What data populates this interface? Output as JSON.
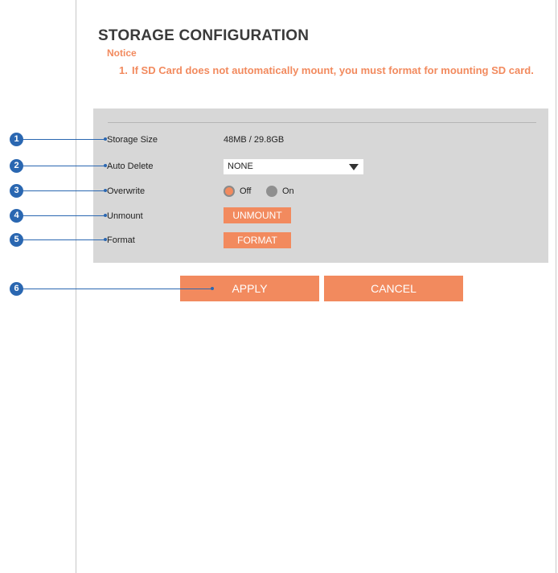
{
  "page": {
    "title": "STORAGE CONFIGURATION",
    "notice_title": "Notice",
    "notice_items": [
      {
        "number": "1.",
        "text": "If SD Card does not automatically mount, you must format for mounting SD card."
      }
    ]
  },
  "form": {
    "storage_size": {
      "label": "Storage Size",
      "value": "48MB / 29.8GB"
    },
    "auto_delete": {
      "label": "Auto Delete",
      "selected": "NONE"
    },
    "overwrite": {
      "label": "Overwrite",
      "options": [
        {
          "label": "Off",
          "checked": true
        },
        {
          "label": "On",
          "checked": false
        }
      ]
    },
    "unmount": {
      "label": "Unmount",
      "button": "UNMOUNT"
    },
    "format": {
      "label": "Format",
      "button": "FORMAT"
    }
  },
  "actions": {
    "apply": "APPLY",
    "cancel": "CANCEL"
  },
  "callouts": [
    "1",
    "2",
    "3",
    "4",
    "5",
    "6"
  ],
  "colors": {
    "accent": "#f28a5e",
    "callout": "#2a67b1",
    "panel": "#d7d7d7"
  }
}
